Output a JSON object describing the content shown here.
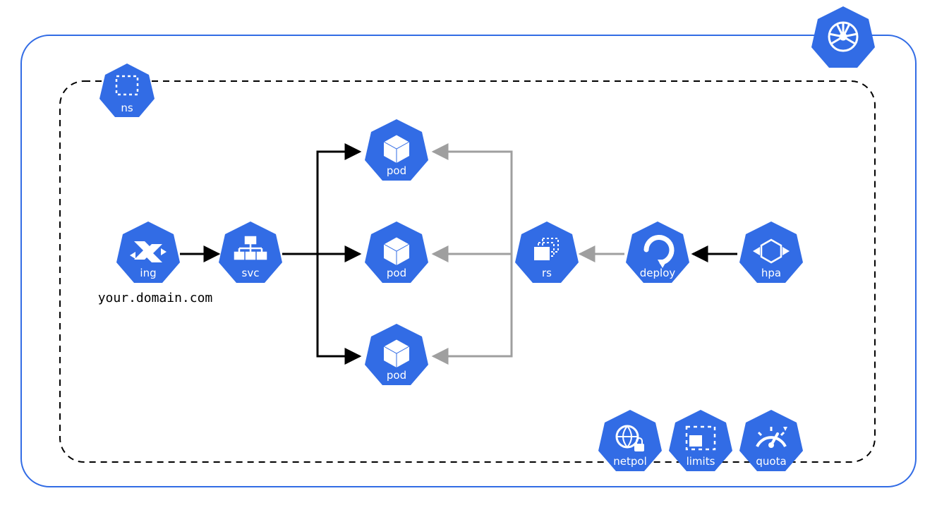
{
  "diagram": {
    "caption": "your.domain.com",
    "nodes": {
      "ns": {
        "label": "ns"
      },
      "ing": {
        "label": "ing"
      },
      "svc": {
        "label": "svc"
      },
      "pod1": {
        "label": "pod"
      },
      "pod2": {
        "label": "pod"
      },
      "pod3": {
        "label": "pod"
      },
      "rs": {
        "label": "rs"
      },
      "deploy": {
        "label": "deploy"
      },
      "hpa": {
        "label": "hpa"
      },
      "netpol": {
        "label": "netpol"
      },
      "limits": {
        "label": "limits"
      },
      "quota": {
        "label": "quota"
      }
    },
    "cluster_icon": "kubernetes-wheel"
  }
}
